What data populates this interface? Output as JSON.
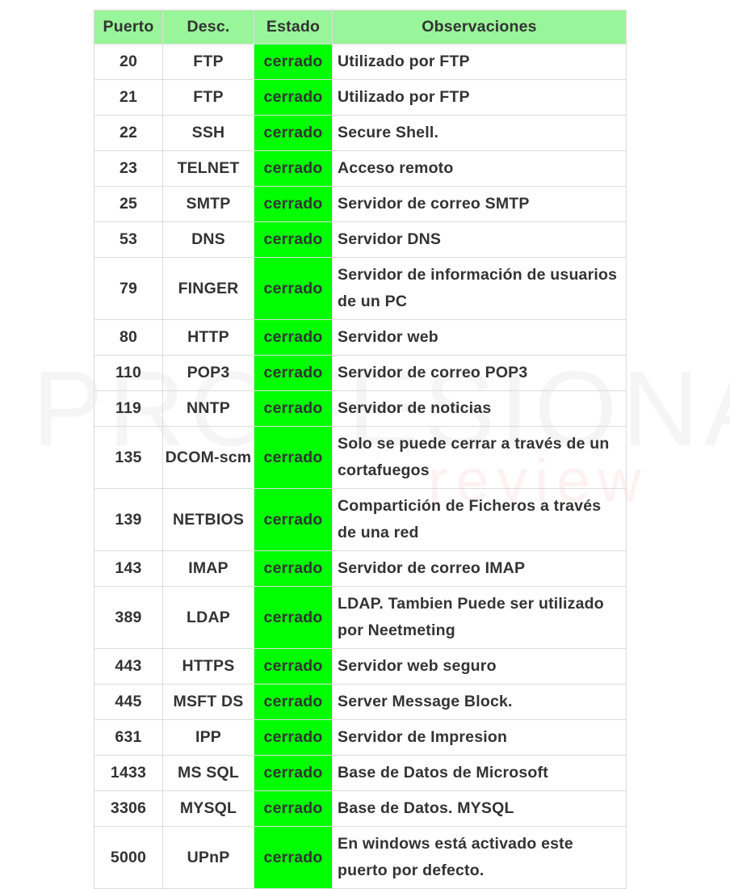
{
  "watermark": {
    "main": "PROFESIONAL",
    "sub": "review"
  },
  "table": {
    "headers": {
      "port": "Puerto",
      "desc": "Desc.",
      "state": "Estado",
      "obs": "Observaciones"
    },
    "rows": [
      {
        "port": "20",
        "desc": "FTP",
        "state": "cerrado",
        "obs": "Utilizado por FTP"
      },
      {
        "port": "21",
        "desc": "FTP",
        "state": "cerrado",
        "obs": "Utilizado por FTP"
      },
      {
        "port": "22",
        "desc": "SSH",
        "state": "cerrado",
        "obs": "Secure Shell."
      },
      {
        "port": "23",
        "desc": "TELNET",
        "state": "cerrado",
        "obs": "Acceso remoto"
      },
      {
        "port": "25",
        "desc": "SMTP",
        "state": "cerrado",
        "obs": "Servidor de correo SMTP"
      },
      {
        "port": "53",
        "desc": "DNS",
        "state": "cerrado",
        "obs": "Servidor DNS"
      },
      {
        "port": "79",
        "desc": "FINGER",
        "state": "cerrado",
        "obs": "Servidor de información de usuarios de un PC"
      },
      {
        "port": "80",
        "desc": "HTTP",
        "state": "cerrado",
        "obs": "Servidor web"
      },
      {
        "port": "110",
        "desc": "POP3",
        "state": "cerrado",
        "obs": "Servidor de correo POP3"
      },
      {
        "port": "119",
        "desc": "NNTP",
        "state": "cerrado",
        "obs": "Servidor de noticias"
      },
      {
        "port": "135",
        "desc": "DCOM-scm",
        "state": "cerrado",
        "obs": "Solo se puede cerrar a través de un cortafuegos"
      },
      {
        "port": "139",
        "desc": "NETBIOS",
        "state": "cerrado",
        "obs": "Compartición de Ficheros a través de una red"
      },
      {
        "port": "143",
        "desc": "IMAP",
        "state": "cerrado",
        "obs": "Servidor de correo IMAP"
      },
      {
        "port": "389",
        "desc": "LDAP",
        "state": "cerrado",
        "obs": "LDAP. Tambien Puede ser utilizado por Neetmeting"
      },
      {
        "port": "443",
        "desc": "HTTPS",
        "state": "cerrado",
        "obs": "Servidor web seguro"
      },
      {
        "port": "445",
        "desc": "MSFT DS",
        "state": "cerrado",
        "obs": "Server Message Block."
      },
      {
        "port": "631",
        "desc": "IPP",
        "state": "cerrado",
        "obs": "Servidor de Impresion"
      },
      {
        "port": "1433",
        "desc": "MS SQL",
        "state": "cerrado",
        "obs": "Base de Datos de Microsoft"
      },
      {
        "port": "3306",
        "desc": "MYSQL",
        "state": "cerrado",
        "obs": "Base de Datos. MYSQL"
      },
      {
        "port": "5000",
        "desc": "UPnP",
        "state": "cerrado",
        "obs": "En windows está activado este puerto por defecto."
      }
    ]
  },
  "colors": {
    "header_bg": "#99f599",
    "state_bg": "#00ff00",
    "text": "#333333",
    "border": "#dcdcdc"
  }
}
